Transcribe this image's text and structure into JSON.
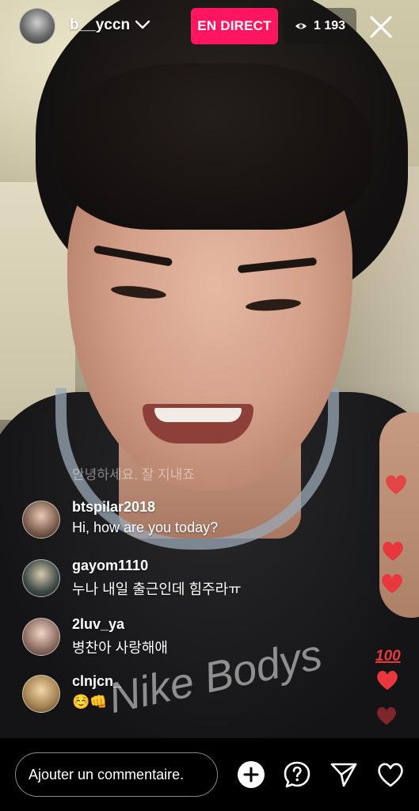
{
  "header": {
    "username": "b__yccn",
    "live_label": "EN DIRECT",
    "viewer_count": "1 193"
  },
  "video": {
    "faded_overlay_comment": "안녕하세요. 잘 지내죠",
    "shirt_print_text": "Nike Bodys"
  },
  "comments": [
    {
      "username": "btspilar2018",
      "text": "Hi, how are you today?"
    },
    {
      "username": "gayom1110",
      "text": "누나 내일 출근인데 힘주라ㅠ"
    },
    {
      "username": "2luv_ya",
      "text": "병찬아 사랑해애"
    },
    {
      "username": "clnjcn_",
      "text": "☺️👊"
    }
  ],
  "reactions": {
    "hundred_label": "100",
    "heart_color": "#e8383d"
  },
  "footer": {
    "comment_placeholder": "Ajouter un commentaire.",
    "icons": [
      "add-icon",
      "question-icon",
      "send-icon",
      "heart-icon"
    ]
  },
  "colors": {
    "live_badge": "#ff1560",
    "background": "#000000"
  }
}
